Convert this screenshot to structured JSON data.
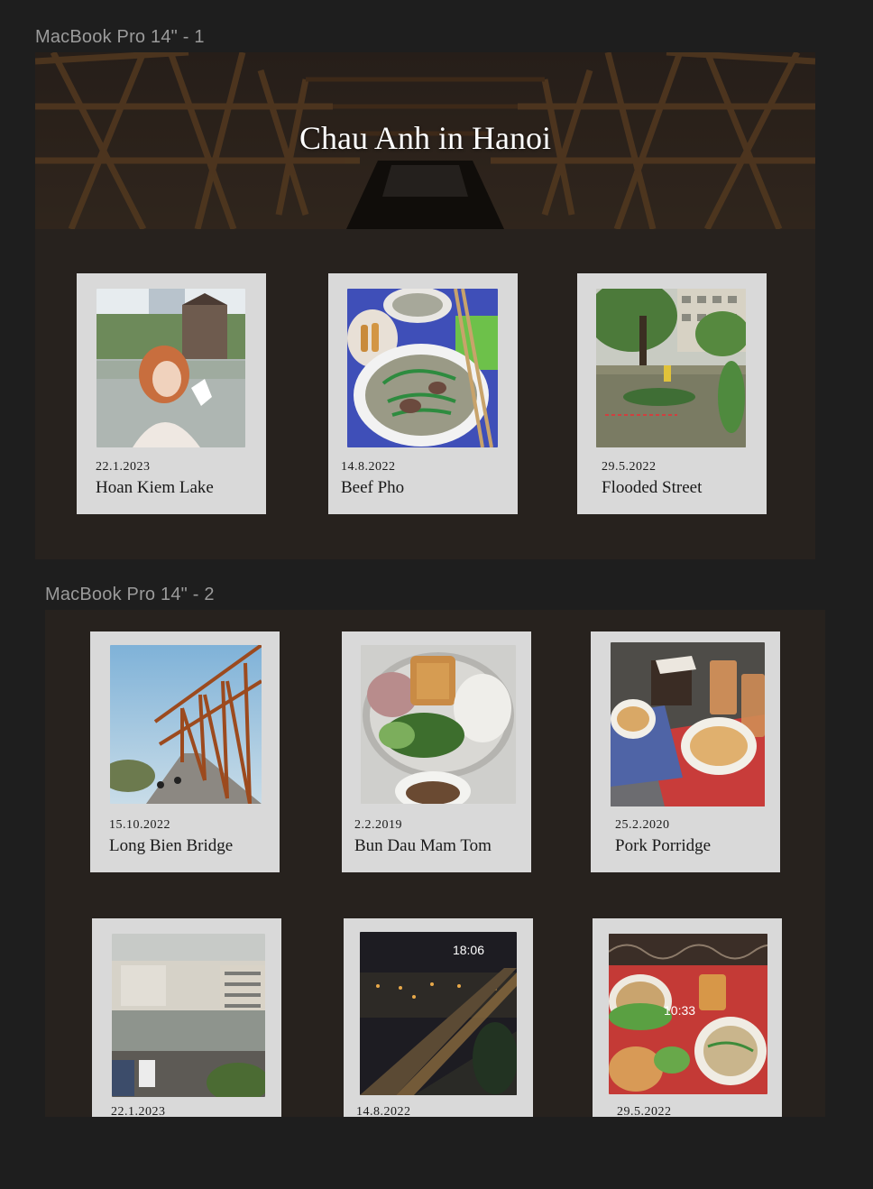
{
  "frames": {
    "frame1_label": "MacBook Pro 14\" - 1",
    "frame2_label": "MacBook Pro 14\" - 2"
  },
  "hero": {
    "title": "Chau Anh in Hanoi"
  },
  "cards_page1": [
    {
      "date": "22.1.2023",
      "title": "Hoan Kiem Lake",
      "photo": "girl-at-lake-photo"
    },
    {
      "date": "14.8.2022",
      "title": "Beef Pho",
      "photo": "pho-bowl-photo"
    },
    {
      "date": "29.5.2022",
      "title": "Flooded Street",
      "photo": "flooded-street-photo"
    }
  ],
  "cards_page2": [
    {
      "date": "15.10.2022",
      "title": "Long Bien Bridge",
      "photo": "bridge-photo"
    },
    {
      "date": "2.2.2019",
      "title": "Bun Dau Mam Tom",
      "photo": "bun-dau-photo"
    },
    {
      "date": "25.2.2020",
      "title": "Pork Porridge",
      "photo": "porridge-photo"
    },
    {
      "date": "22.1.2023",
      "title": "",
      "photo": "city-rain-photo"
    },
    {
      "date": "14.8.2022",
      "title": "",
      "photo": "night-bridge-photo",
      "overlay": "18:06"
    },
    {
      "date": "29.5.2022",
      "title": "",
      "photo": "noodle-table-photo",
      "overlay": "10:33"
    }
  ],
  "colors": {
    "canvas": "#1e1e1e",
    "frame_bg": "#27221e",
    "card_bg": "#d9d9d9",
    "label_gray": "#9b9b9b"
  }
}
